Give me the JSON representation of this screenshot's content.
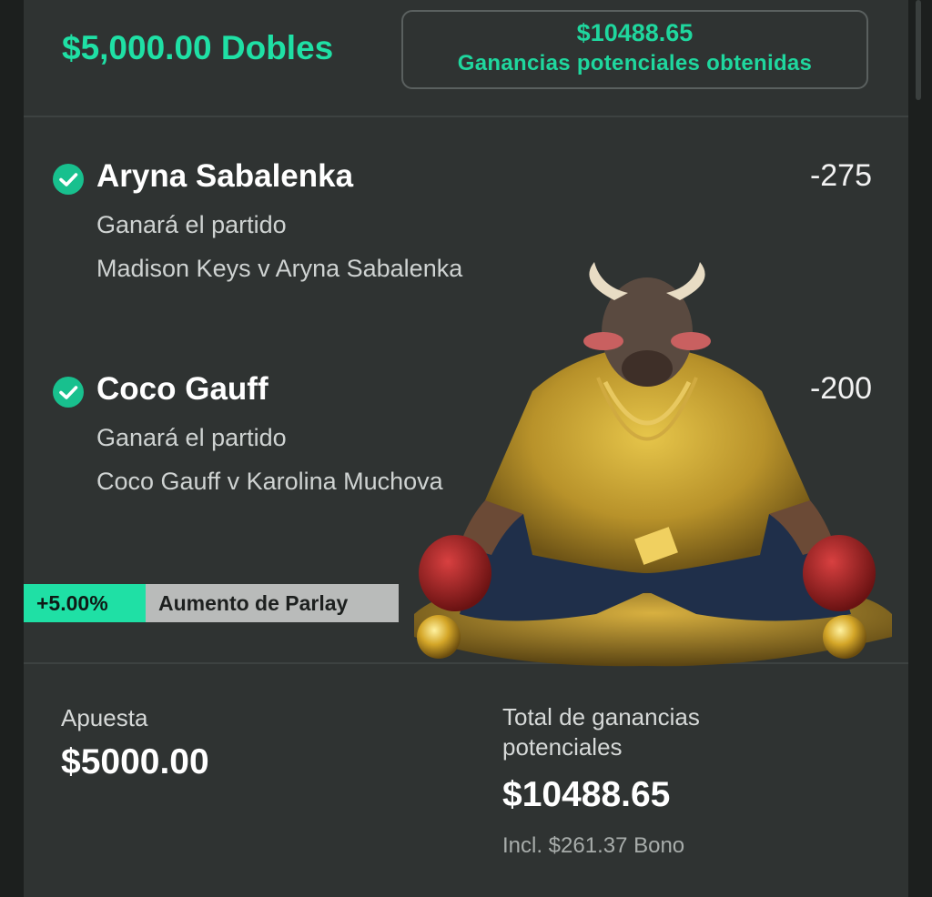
{
  "header": {
    "stake_title": "$5,000.00 Dobles",
    "potential_amount": "$10488.65",
    "potential_caption": "Ganancias potenciales obtenidas"
  },
  "selections": [
    {
      "player": "Aryna Sabalenka",
      "odds": "-275",
      "market": "Ganará el partido",
      "event": "Madison Keys v Aryna Sabalenka",
      "status_icon": "check-circle-icon"
    },
    {
      "player": "Coco Gauff",
      "odds": "-200",
      "market": "Ganará el partido",
      "event": "Coco Gauff v Karolina Muchova",
      "status_icon": "check-circle-icon"
    }
  ],
  "boost": {
    "percent": "+5.00%",
    "label": "Aumento de Parlay"
  },
  "footer": {
    "stake_label": "Apuesta",
    "stake_value": "$5000.00",
    "total_label": "Total de ganancias potenciales",
    "total_value": "$10488.65",
    "bonus_note": "Incl. $261.37 Bono"
  },
  "overlay_image": "bull-mascot-sticker",
  "colors": {
    "accent_green": "#1fe0a5",
    "check_green": "#18c08e",
    "card_bg": "#2f3332",
    "boost_label_bg": "#b9bbba"
  }
}
